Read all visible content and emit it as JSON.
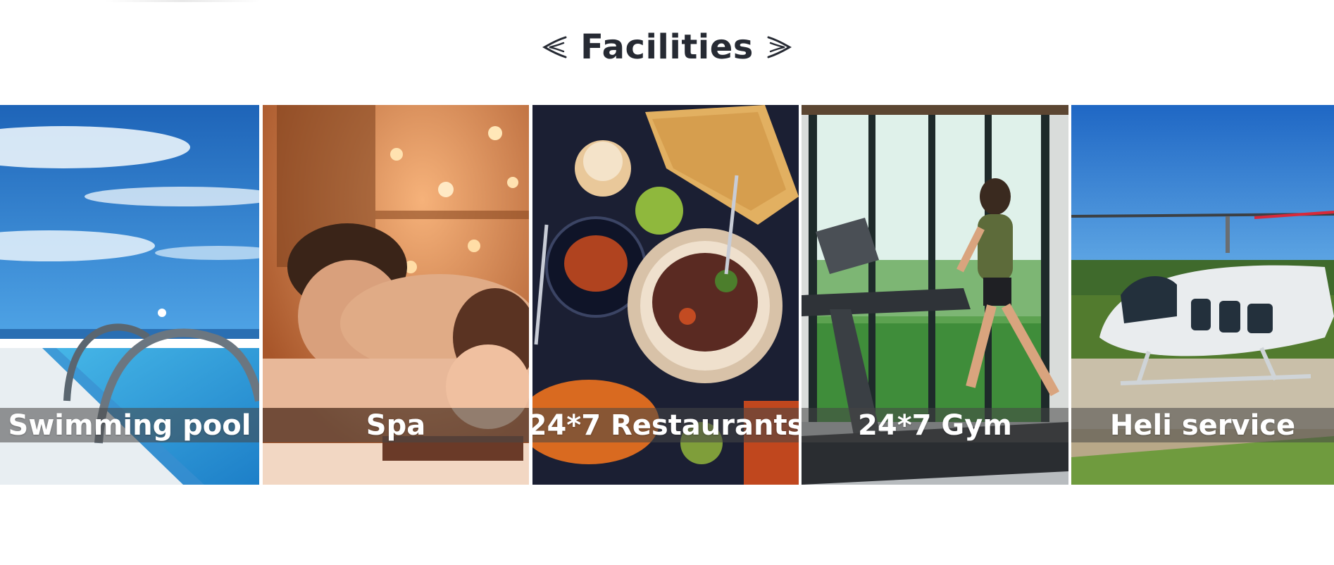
{
  "section": {
    "title": "Facilities",
    "ornament_left": "left-swash-icon",
    "ornament_right": "right-swash-icon"
  },
  "facilities": [
    {
      "label": "Swimming pool",
      "image": "swimming-pool-photo"
    },
    {
      "label": "Spa",
      "image": "spa-massage-photo"
    },
    {
      "label": "24*7 Restaurants",
      "image": "restaurant-food-photo"
    },
    {
      "label": "24*7 Gym",
      "image": "gym-treadmill-photo"
    },
    {
      "label": "Heli service",
      "image": "helicopter-photo"
    }
  ],
  "colors": {
    "title": "#262a33",
    "caption_text": "#ffffff",
    "caption_band": "rgba(70,70,70,0.55)",
    "background": "#ffffff"
  }
}
